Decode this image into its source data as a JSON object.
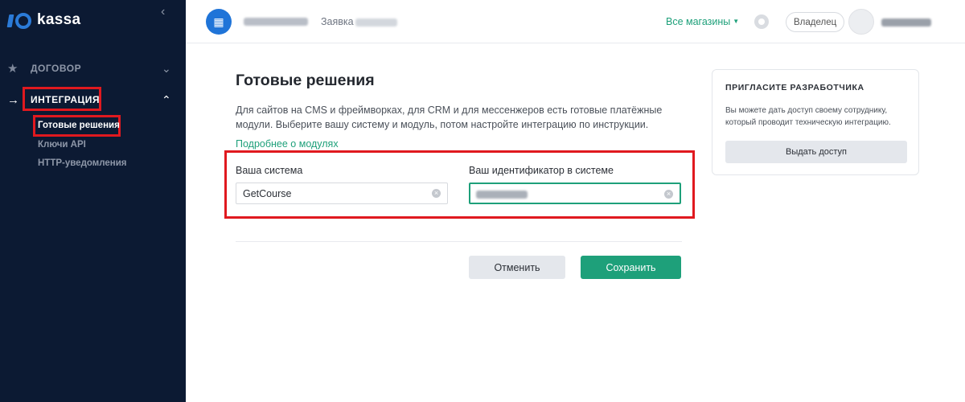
{
  "brand": {
    "name": "kassa"
  },
  "sidebar": {
    "items": [
      {
        "label": "ДОГОВОР",
        "icon": "star-icon",
        "expanded": false
      },
      {
        "label": "ИНТЕГРАЦИЯ",
        "icon": "arrow-right-icon",
        "expanded": true
      }
    ],
    "subitems": [
      {
        "label": "Готовые решения",
        "active": true
      },
      {
        "label": "Ключи API",
        "active": false
      },
      {
        "label": "HTTP-уведомления",
        "active": false
      }
    ]
  },
  "header": {
    "app_label": "Заявка",
    "stores_label": "Все магазины",
    "role_label": "Владелец"
  },
  "main": {
    "title": "Готовые решения",
    "description": "Для сайтов на CMS и фреймворках, для CRM и для мессенжеров есть готовые платёжные модули. Выберите вашу систему и модуль, потом настройте интеграцию по инструкции.",
    "more_link": "Подробнее о модулях",
    "system_label": "Ваша система",
    "system_value": "GetCourse",
    "identifier_label": "Ваш идентификатор в системе",
    "cancel_label": "Отменить",
    "save_label": "Сохранить"
  },
  "invite": {
    "title": "ПРИГЛАСИТЕ РАЗРАБОТЧИКА",
    "text": "Вы можете дать доступ своему сотруднику, который проводит техническую интеграцию.",
    "button_label": "Выдать доступ"
  },
  "colors": {
    "sidebar_bg": "#0c1a33",
    "accent_green": "#1ea07a",
    "brand_blue": "#2b7bd8",
    "highlight_red": "#e0191f"
  }
}
